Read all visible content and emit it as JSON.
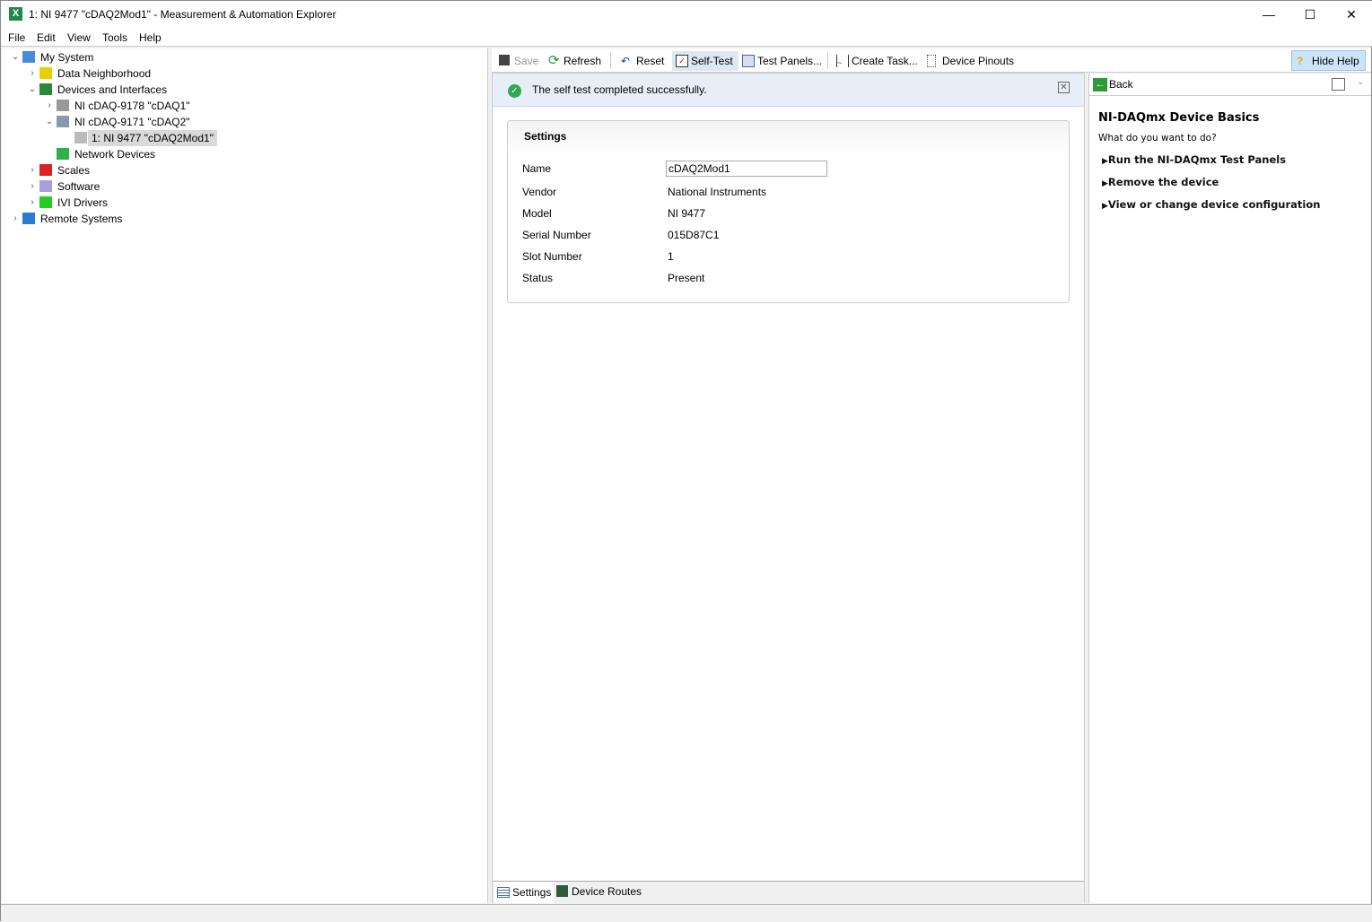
{
  "window": {
    "title": "1: NI 9477 \"cDAQ2Mod1\" - Measurement & Automation Explorer",
    "minimize": "—",
    "maximize": "☐",
    "close": "✕",
    "app_icon": "X"
  },
  "menu": [
    "File",
    "Edit",
    "View",
    "Tools",
    "Help"
  ],
  "tree": [
    {
      "label": "My System",
      "level": 0,
      "expander": "expanded",
      "icon": "computer-icon"
    },
    {
      "label": "Data Neighborhood",
      "level": 1,
      "expander": "collapsed",
      "icon": "data-neighborhood-icon"
    },
    {
      "label": "Devices and Interfaces",
      "level": 1,
      "expander": "expanded",
      "icon": "devices-icon"
    },
    {
      "label": "NI cDAQ-9178 \"cDAQ1\"",
      "level": 2,
      "expander": "collapsed",
      "icon": "chassis-error-icon"
    },
    {
      "label": "NI cDAQ-9171 \"cDAQ2\"",
      "level": 2,
      "expander": "expanded",
      "icon": "chassis-icon"
    },
    {
      "label": "1: NI 9477 \"cDAQ2Mod1\"",
      "level": 3,
      "expander": "none",
      "icon": "module-icon",
      "selected": true
    },
    {
      "label": "Network Devices",
      "level": 2,
      "expander": "none",
      "icon": "network-icon"
    },
    {
      "label": "Scales",
      "level": 1,
      "expander": "collapsed",
      "icon": "scales-icon"
    },
    {
      "label": "Software",
      "level": 1,
      "expander": "collapsed",
      "icon": "software-icon"
    },
    {
      "label": "IVI Drivers",
      "level": 1,
      "expander": "collapsed",
      "icon": "ivi-icon"
    },
    {
      "label": "Remote Systems",
      "level": 0,
      "expander": "collapsed",
      "icon": "remote-systems-icon"
    }
  ],
  "toolbar": {
    "save": "Save",
    "refresh": "Refresh",
    "reset": "Reset",
    "self_test": "Self-Test",
    "test_panels": "Test Panels...",
    "create_task": "Create Task...",
    "device_pinouts": "Device Pinouts",
    "hide_help": "Hide Help"
  },
  "banner": {
    "message": "The self test completed successfully."
  },
  "settings": {
    "title": "Settings",
    "name_label": "Name",
    "name_value": "cDAQ2Mod1",
    "fields": [
      {
        "label": "Vendor",
        "value": "National Instruments"
      },
      {
        "label": "Model",
        "value": "NI 9477"
      },
      {
        "label": "Serial Number",
        "value": "015D87C1"
      },
      {
        "label": "Slot Number",
        "value": "1"
      },
      {
        "label": "Status",
        "value": "Present"
      }
    ]
  },
  "tabs": {
    "settings": "Settings",
    "device_routes": "Device Routes"
  },
  "help": {
    "back": "Back",
    "title": "NI-DAQmx Device Basics",
    "subtitle": "What do you want to do?",
    "links": [
      "Run the NI-DAQmx Test Panels",
      "Remove the device",
      "View or change device configuration"
    ]
  }
}
